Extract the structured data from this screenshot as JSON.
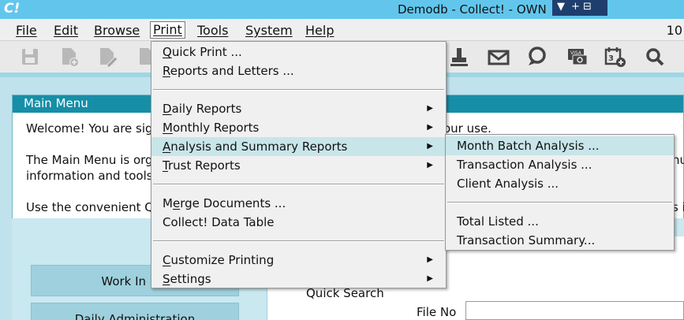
{
  "window": {
    "app_logo": "C!",
    "title": "Demodb - Collect! - OWN",
    "ctrl_pin": "▼",
    "ctrl_plus": "+ ⊟"
  },
  "menubar": {
    "items": [
      {
        "label": "File"
      },
      {
        "label": "Edit"
      },
      {
        "label": "Browse"
      },
      {
        "label": "Print"
      },
      {
        "label": "Tools"
      },
      {
        "label": "System"
      },
      {
        "label": "Help"
      }
    ],
    "right_text": "10"
  },
  "toolbar": {
    "left_icons": [
      "save-icon",
      "new-document-icon",
      "edit-document-icon",
      "document-icon"
    ],
    "right_icons": [
      "print-stamp-icon",
      "envelope-icon",
      "chat-bubble-icon",
      "credit-card-icon",
      "calendar-add-icon",
      "search-icon"
    ]
  },
  "print_menu": {
    "items": [
      {
        "label": "Quick Print ...",
        "u": "Q",
        "rest": "uick Print ..."
      },
      {
        "label": "Reports and Letters ...",
        "u": "R",
        "rest": "eports and Letters ..."
      },
      {
        "label": "Daily Reports",
        "u": "D",
        "rest": "aily Reports"
      },
      {
        "label": "Monthly Reports",
        "u": "M",
        "rest": "onthly Reports"
      },
      {
        "label": "Analysis and Summary Reports",
        "u": "A",
        "rest": "nalysis and Summary Reports"
      },
      {
        "label": "Trust Reports",
        "u": "T",
        "rest": "rust Reports"
      },
      {
        "label": "Merge Documents ...",
        "pre": "M",
        "u": "e",
        "rest": "rge Documents ..."
      },
      {
        "label": "Collect! Data Table"
      },
      {
        "label": "Customize Printing",
        "u": "C",
        "rest": "ustomize Printing"
      },
      {
        "label": "Settings",
        "u": "S",
        "rest": "ettings"
      }
    ],
    "arrow": "▶"
  },
  "analysis_submenu": {
    "items": [
      {
        "label": "Month Batch Analysis ..."
      },
      {
        "label": "Transaction Analysis ..."
      },
      {
        "label": "Client Analysis ..."
      },
      {
        "label": "Total Listed ..."
      },
      {
        "label": "Transaction Summary..."
      }
    ]
  },
  "main_menu": {
    "header": "Main Menu",
    "welcome_left": "Welcome! You are sign",
    "welcome_right": "our use.",
    "organized_left": "The Main Menu is orga",
    "organized_right": "nu",
    "info_left": "information and tools.",
    "convenient_left": "Use the convenient Qu",
    "convenient_right": "s in",
    "buttons": [
      {
        "label": "Work In Pro"
      },
      {
        "label": "Daily Administration"
      }
    ],
    "quick_search_title": "Quick Search",
    "file_no_label": "File No",
    "file_no_value": ""
  }
}
